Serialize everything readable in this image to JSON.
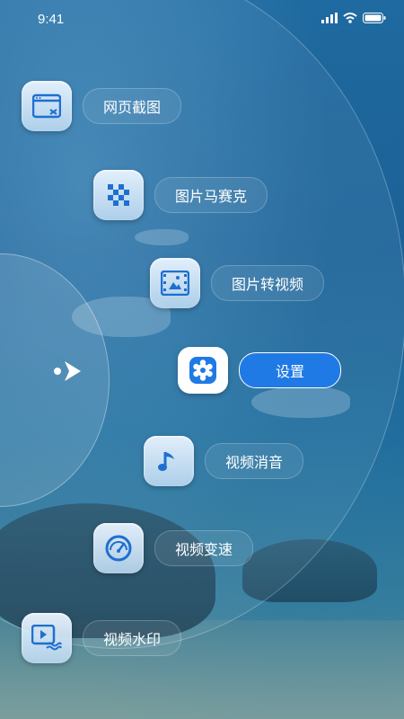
{
  "status_bar": {
    "time": "9:41"
  },
  "menu": [
    {
      "label": "网页截图",
      "icon": "webpage-screenshot-icon"
    },
    {
      "label": "图片马赛克",
      "icon": "mosaic-icon"
    },
    {
      "label": "图片转视频",
      "icon": "image-to-video-icon"
    },
    {
      "label": "设置",
      "icon": "gear-icon",
      "active": true
    },
    {
      "label": "视频消音",
      "icon": "music-note-icon"
    },
    {
      "label": "视频变速",
      "icon": "speedometer-icon"
    },
    {
      "label": "视频水印",
      "icon": "watermark-icon"
    }
  ],
  "colors": {
    "accent": "#1f7ae6",
    "icon_blue": "#1f6fd0",
    "background": "#1f6aa0"
  }
}
